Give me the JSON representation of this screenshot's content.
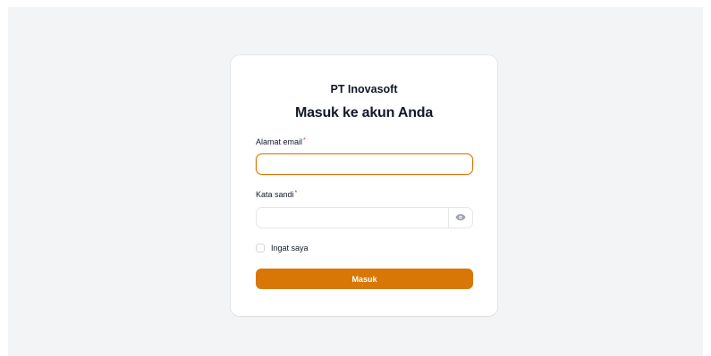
{
  "brand": {
    "name": "PT Inovasoft"
  },
  "form": {
    "heading": "Masuk ke akun Anda",
    "email": {
      "label": "Alamat email",
      "required_mark": "*",
      "value": "",
      "placeholder": ""
    },
    "password": {
      "label": "Kata sandi",
      "required_mark": "*",
      "value": "",
      "placeholder": "",
      "toggle_icon": "eye-icon"
    },
    "remember": {
      "label": "Ingat saya",
      "checked": false
    },
    "submit_label": "Masuk"
  },
  "colors": {
    "accent": "#d97706",
    "background": "#f3f4f6",
    "required": "#dc2626"
  }
}
